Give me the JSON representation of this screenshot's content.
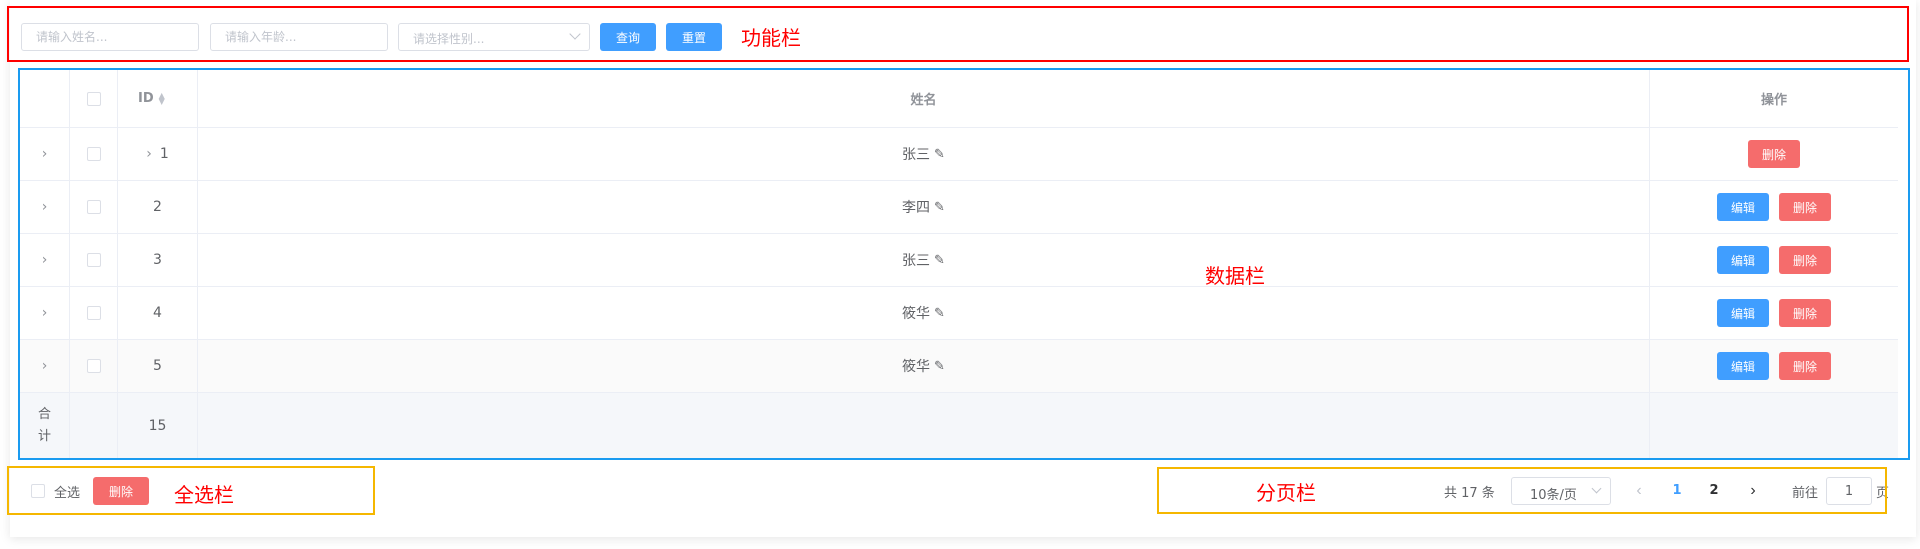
{
  "toolbar": {
    "name_placeholder": "请输入姓名...",
    "age_placeholder": "请输入年龄...",
    "gender_placeholder": "请选择性别...",
    "search_label": "查询",
    "reset_label": "重置"
  },
  "table": {
    "columns": {
      "id": "ID",
      "name": "姓名",
      "ops": "操作"
    },
    "rows": [
      {
        "id": "1",
        "name": "张三"
      },
      {
        "id": "2",
        "name": "李四"
      },
      {
        "id": "3",
        "name": "张三"
      },
      {
        "id": "4",
        "name": "筱华"
      },
      {
        "id": "5",
        "name": "筱华"
      }
    ],
    "edit_label": "编辑",
    "delete_label": "删除",
    "summary": {
      "label": "合计",
      "id_total": "15"
    }
  },
  "footer": {
    "select_all_label": "全选",
    "delete_label": "删除",
    "total_text": "共 17 条",
    "page_size": "10条/页",
    "pages": [
      "1",
      "2"
    ],
    "current_page": "1",
    "goto_prefix": "前往",
    "goto_value": "1",
    "goto_suffix": "页"
  },
  "annotations": {
    "toolbar": "功能栏",
    "data": "数据栏",
    "select_all": "全选栏",
    "pagination": "分页栏"
  },
  "colors": {
    "primary": "#409eff",
    "danger": "#f56c6c",
    "annotation_red": "#ff0000",
    "annotation_blue": "#1a9bf0",
    "annotation_yellow": "#f5b700"
  }
}
